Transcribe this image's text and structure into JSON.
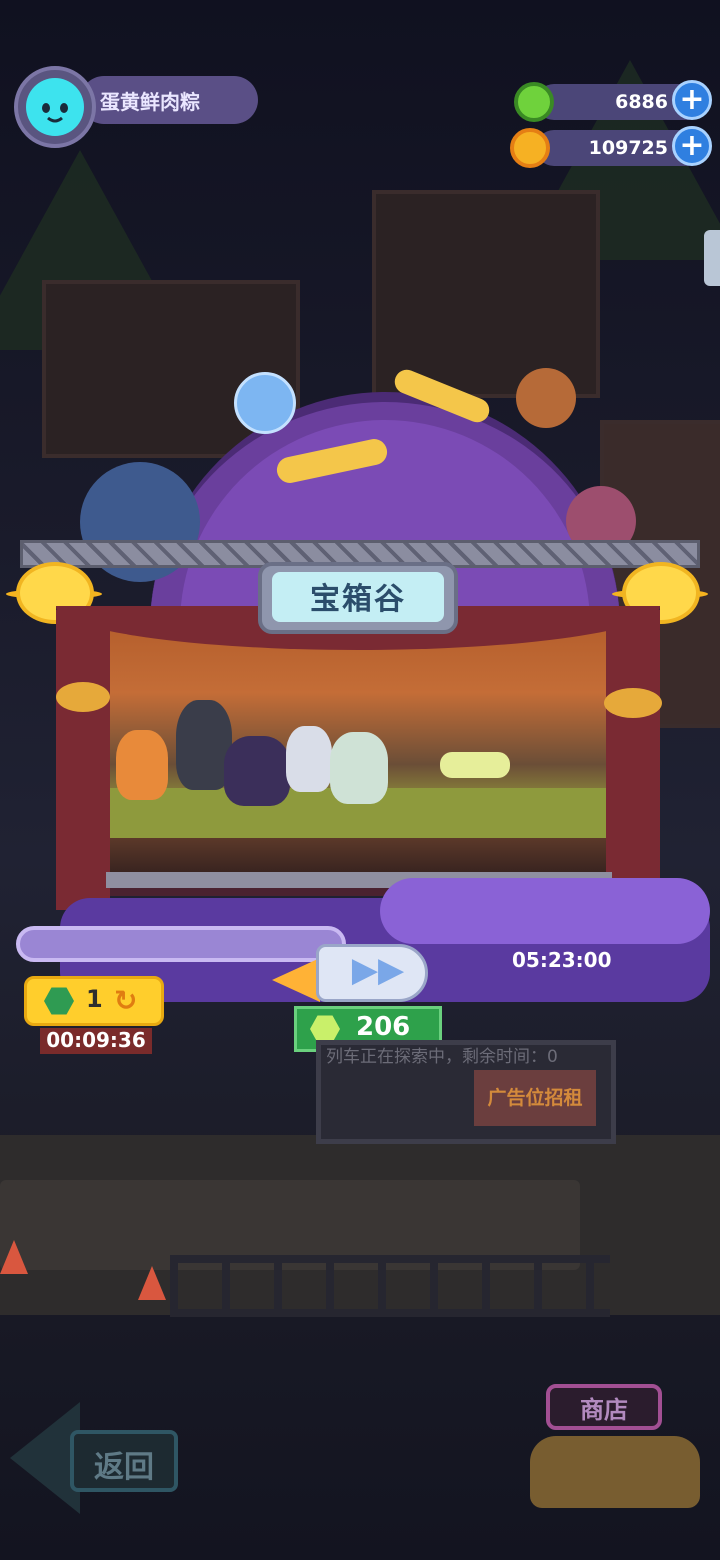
{
  "player": {
    "name": "蛋黄鲜肉粽",
    "avatar_icon": "cat-face-icon"
  },
  "resources": {
    "gems": {
      "value": "6886",
      "icon": "green-gem-icon",
      "add_label": "+"
    },
    "coins": {
      "value": "109725",
      "icon": "gold-planet-coin-icon",
      "add_label": "+"
    }
  },
  "stage": {
    "location_title": "宝箱谷"
  },
  "expedition": {
    "remaining_time": "05:23:00",
    "fast_forward_icon": "fast-forward-icon",
    "accelerate_cost": "206",
    "speedup": {
      "count": "1",
      "timer": "00:09:36",
      "icon": "refresh-icon"
    }
  },
  "billboard": {
    "ticker_text": "列车正在探索中，剩余时间：0",
    "ad_text": "广告位招租"
  },
  "nav": {
    "back_label": "返回",
    "shop_label": "商店"
  },
  "colors": {
    "accent_purple": "#6a3f9d",
    "gem_green": "#2ea14b",
    "speed_yellow": "#ffce2c",
    "plus_blue": "#2f7fe0"
  }
}
